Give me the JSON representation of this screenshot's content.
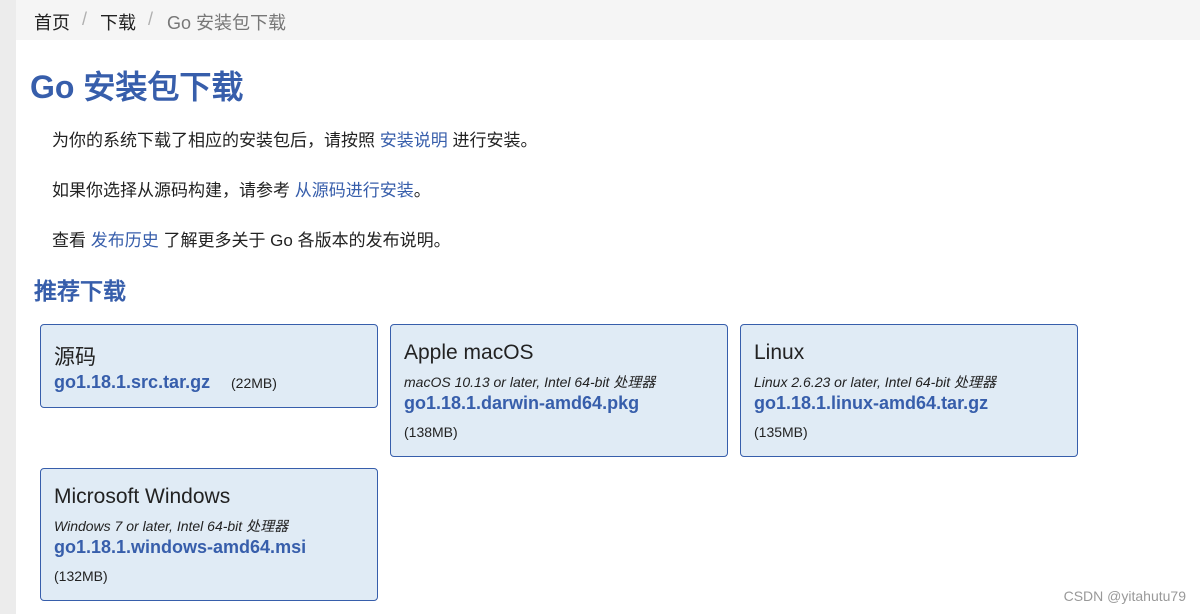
{
  "breadcrumb": {
    "items": [
      "首页",
      "下载",
      "Go 安装包下载"
    ],
    "separator": "/"
  },
  "page": {
    "title": "Go 安装包下载",
    "para1": {
      "before": "为你的系统下载了相应的安装包后，请按照 ",
      "link": "安装说明",
      "after": " 进行安装。"
    },
    "para2": {
      "before": "如果你选择从源码构建，请参考 ",
      "link": "从源码进行安装",
      "after": "。"
    },
    "para3": {
      "before": "查看 ",
      "link": "发布历史",
      "after": " 了解更多关于 Go 各版本的发布说明。"
    },
    "section_title": "推荐下载"
  },
  "downloads": [
    {
      "platform": "源码",
      "requirements": "",
      "filename": "go1.18.1.src.tar.gz",
      "size": "(22MB)"
    },
    {
      "platform": "Apple macOS",
      "requirements": "macOS 10.13 or later, Intel 64-bit 处理器",
      "filename": "go1.18.1.darwin-amd64.pkg",
      "size": "(138MB)"
    },
    {
      "platform": "Linux",
      "requirements": "Linux 2.6.23 or later, Intel 64-bit 处理器",
      "filename": "go1.18.1.linux-amd64.tar.gz",
      "size": "(135MB)"
    },
    {
      "platform": "Microsoft Windows",
      "requirements": "Windows 7 or later, Intel 64-bit 处理器",
      "filename": "go1.18.1.windows-amd64.msi",
      "size": "(132MB)"
    }
  ],
  "watermark": "CSDN @yitahutu79",
  "colors": {
    "accent": "#375eab",
    "card_bg": "#e0ebf5",
    "breadcrumb_bg": "#f5f5f5"
  }
}
